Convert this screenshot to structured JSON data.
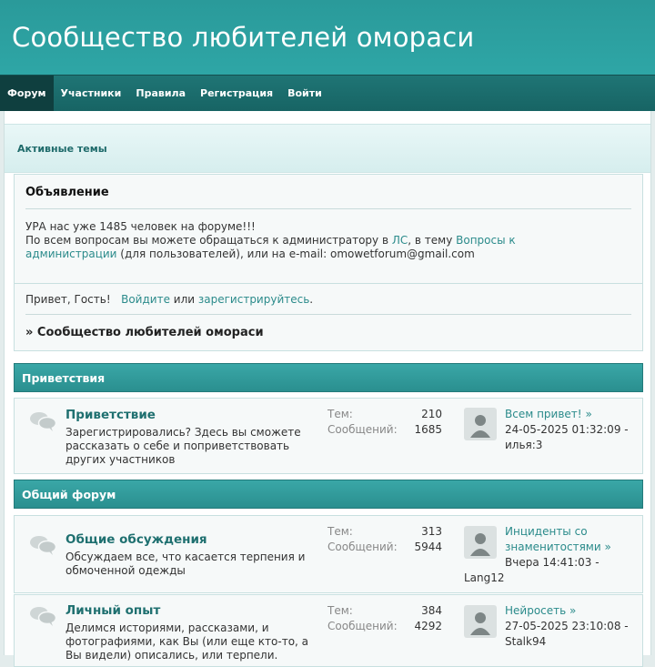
{
  "header": {
    "title": "Сообщество любителей омораси"
  },
  "nav": {
    "items": [
      "Форум",
      "Участники",
      "Правила",
      "Регистрация",
      "Войти"
    ]
  },
  "active_topics": {
    "label": "Активные темы"
  },
  "announcement": {
    "title": "Объявление",
    "line1": "УРА нас уже 1485 человек на форуме!!!",
    "line2_pre": "По всем вопросам вы можете обращаться к администратору в ",
    "line2_link1": "ЛС",
    "line2_mid": ", в тему ",
    "line2_link2a": "Вопросы к",
    "line2_link2b": "администрации",
    "line2_post": " (для пользователей), или на e-mail: omowetforum@gmail.com"
  },
  "welcome": {
    "greeting": "Привет, Гость!",
    "login": "Войдите",
    "or": "или",
    "register": "зарегистрируйтесь",
    "period": ".",
    "crumb": "» Сообщество любителей омораси"
  },
  "categories": [
    {
      "name": "Приветствия",
      "forums": [
        {
          "title": "Приветствие",
          "desc": "Зарегистрировались? Здесь вы сможете рассказать о себе и поприветствовать других участников",
          "topics_label": "Тем:",
          "topics": "210",
          "posts_label": "Сообщений:",
          "posts": "1685",
          "last_title": "Всем привет!",
          "last_date": "24-05-2025 01:32:09 -",
          "last_user": "илья:3"
        }
      ]
    },
    {
      "name": "Общий форум",
      "forums": [
        {
          "title": "Общие обсуждения",
          "desc": "Обсуждаем все, что касается терпения и обмоченной одежды",
          "topics_label": "Тем:",
          "topics": "313",
          "posts_label": "Сообщений:",
          "posts": "5944",
          "last_title_a": "Инциденты со",
          "last_title_b": "знаменитостями",
          "last_date": "Вчера 14:41:03 -",
          "last_user": "Lang12"
        },
        {
          "title": "Личный опыт",
          "desc": "Делимся историями, рассказами, и фотографиями, как Вы (или еще кто-то, а Вы видели) описались, или терпели.",
          "topics_label": "Тем:",
          "topics": "384",
          "posts_label": "Сообщений:",
          "posts": "4292",
          "last_title": "Нейросеть",
          "last_date": "27-05-2025 23:10:08 -",
          "last_user": "Stalk94"
        }
      ]
    }
  ],
  "colors": {
    "accent": "#2a9a9a",
    "nav": "#1a6b6b",
    "link": "#2b8b8b"
  },
  "icons": {
    "forum": "speech-bubbles-icon",
    "avatar": "default-avatar-icon",
    "arrow": "double-chevron-right-icon"
  }
}
